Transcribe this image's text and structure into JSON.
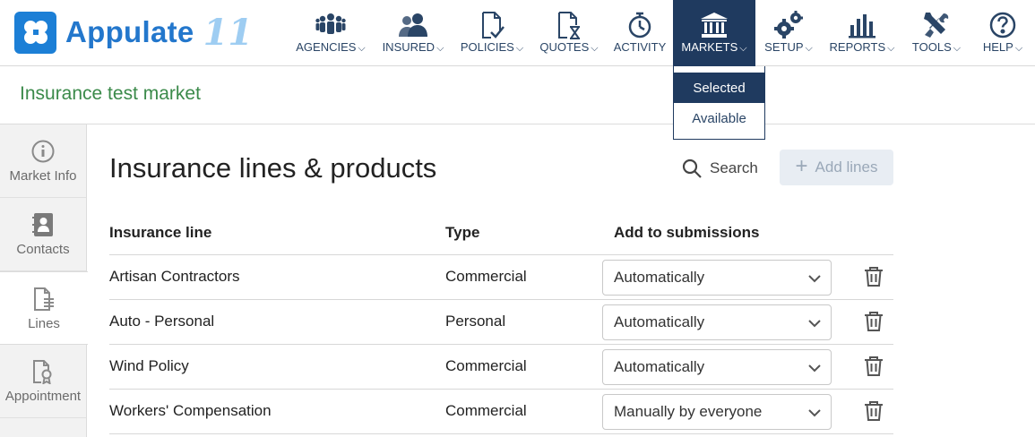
{
  "brand": {
    "name": "Appulate",
    "version": "11"
  },
  "nav": [
    {
      "label": "AGENCIES",
      "icon": "agencies-icon",
      "chevron": true
    },
    {
      "label": "INSURED",
      "icon": "insured-icon",
      "chevron": true
    },
    {
      "label": "POLICIES",
      "icon": "policies-icon",
      "chevron": true
    },
    {
      "label": "QUOTES",
      "icon": "quotes-icon",
      "chevron": true
    },
    {
      "label": "ACTIVITY",
      "icon": "activity-icon",
      "chevron": false
    },
    {
      "label": "MARKETS",
      "icon": "markets-icon",
      "chevron": true,
      "active": true
    },
    {
      "label": "SETUP",
      "icon": "setup-icon",
      "chevron": true
    },
    {
      "label": "REPORTS",
      "icon": "reports-icon",
      "chevron": true
    },
    {
      "label": "TOOLS",
      "icon": "tools-icon",
      "chevron": true
    },
    {
      "label": "HELP",
      "icon": "help-icon",
      "chevron": true
    }
  ],
  "markets_menu": {
    "items": [
      "Selected",
      "Available"
    ],
    "selected": "Selected"
  },
  "market": {
    "title": "Insurance test market"
  },
  "sidebar": {
    "items": [
      {
        "label": "Market Info",
        "icon": "info-icon"
      },
      {
        "label": "Contacts",
        "icon": "contacts-icon"
      },
      {
        "label": "Lines",
        "icon": "lines-document-icon",
        "active": true
      },
      {
        "label": "Appointment",
        "icon": "appointment-certificate-icon"
      }
    ]
  },
  "content": {
    "title": "Insurance lines & products",
    "search_label": "Search",
    "add_label": "Add lines"
  },
  "table": {
    "headers": {
      "line": "Insurance line",
      "type": "Type",
      "add": "Add to submissions"
    },
    "rows": [
      {
        "line": "Artisan Contractors",
        "type": "Commercial",
        "add": "Automatically"
      },
      {
        "line": "Auto - Personal",
        "type": "Personal",
        "add": "Automatically"
      },
      {
        "line": "Wind Policy",
        "type": "Commercial",
        "add": "Automatically"
      },
      {
        "line": "Workers' Compensation",
        "type": "Commercial",
        "add": "Manually by everyone"
      }
    ]
  },
  "colors": {
    "navy": "#1f3a5f",
    "brand_blue": "#1c7fd6",
    "market_green": "#3b8a4a"
  }
}
